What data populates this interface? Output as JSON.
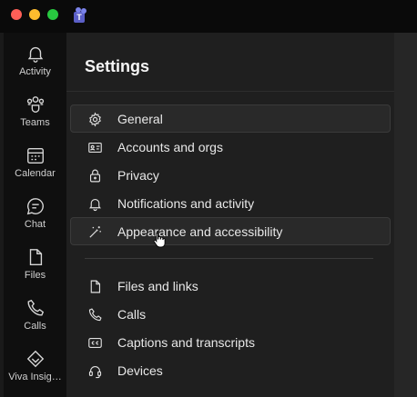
{
  "app": {
    "logo_icon": "teams-logo-icon"
  },
  "rail": {
    "items": [
      {
        "label": "Activity",
        "icon": "bell-icon"
      },
      {
        "label": "Teams",
        "icon": "teams-icon"
      },
      {
        "label": "Calendar",
        "icon": "calendar-icon"
      },
      {
        "label": "Chat",
        "icon": "chat-icon"
      },
      {
        "label": "Files",
        "icon": "file-icon"
      },
      {
        "label": "Calls",
        "icon": "phone-icon"
      },
      {
        "label": "Viva Insig…",
        "icon": "viva-insights-icon"
      }
    ]
  },
  "settings": {
    "title": "Settings",
    "menu": [
      {
        "label": "General",
        "icon": "gear-icon",
        "state": "selected"
      },
      {
        "label": "Accounts and orgs",
        "icon": "id-card-icon"
      },
      {
        "label": "Privacy",
        "icon": "lock-icon"
      },
      {
        "label": "Notifications and activity",
        "icon": "bell-icon"
      },
      {
        "label": "Appearance and accessibility",
        "icon": "magic-wand-icon",
        "state": "hover"
      }
    ],
    "menu2": [
      {
        "label": "Files and links",
        "icon": "file-icon"
      },
      {
        "label": "Calls",
        "icon": "phone-icon"
      },
      {
        "label": "Captions and transcripts",
        "icon": "captions-icon"
      },
      {
        "label": "Devices",
        "icon": "headset-icon"
      }
    ]
  },
  "colors": {
    "background": "#000000",
    "panel": "#1f1f1f",
    "rail": "#0f0f0f",
    "selected_item": "#292929",
    "text": "#e8e8e8"
  }
}
